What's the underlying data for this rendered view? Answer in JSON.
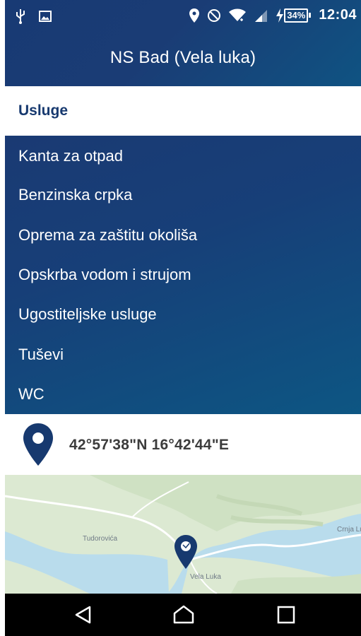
{
  "status_bar": {
    "left_icons": [
      "usb-icon",
      "image-icon"
    ],
    "right_icons": [
      "location-icon",
      "do-not-disturb-icon",
      "wifi-icon",
      "signal-icon",
      "charging-icon"
    ],
    "battery": "34%",
    "time": "12:04"
  },
  "appbar": {
    "title": "NS Bad (Vela luka)"
  },
  "services": {
    "header": "Usluge",
    "items": [
      "Kanta za otpad",
      "Benzinska crpka",
      "Oprema za zaštitu okoliša",
      "Opskrba vodom i strujom",
      "Ugostiteljske usluge",
      "Tuševi",
      "WC"
    ]
  },
  "location": {
    "icon": "map-pin-icon",
    "coordinates": "42°57'38\"N 16°42'44\"E"
  },
  "map": {
    "labels": {
      "west": "Tudorovića",
      "center": "Vela Luka",
      "east": "Crnja Lu"
    },
    "marker_icon": "map-marker-icon"
  },
  "nav_bar": {
    "buttons": [
      "back-icon",
      "home-icon",
      "recents-icon"
    ]
  },
  "colors": {
    "primary": "#1a3c75",
    "accent_end": "#0d5683",
    "text_dark": "#3c3c3c"
  }
}
